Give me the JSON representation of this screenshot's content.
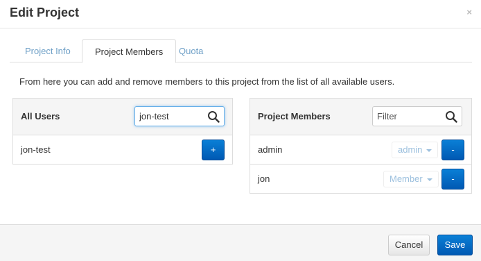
{
  "modal": {
    "title": "Edit Project",
    "close_glyph": "×"
  },
  "tabs": [
    {
      "label": "Project Info",
      "active": false
    },
    {
      "label": "Project Members",
      "active": true
    },
    {
      "label": "Quota",
      "active": false
    }
  ],
  "intro_text": "From here you can add and remove members to this project from the list of all available users.",
  "all_users": {
    "title": "All Users",
    "search_value": "jon-test",
    "search_placeholder": "",
    "rows": [
      {
        "name": "jon-test",
        "action_label": "+"
      }
    ]
  },
  "project_members": {
    "title": "Project Members",
    "search_value": "",
    "search_placeholder": "Filter",
    "rows": [
      {
        "name": "admin",
        "role": "admin",
        "action_label": "-"
      },
      {
        "name": "jon",
        "role": "Member",
        "action_label": "-"
      }
    ]
  },
  "footer": {
    "cancel_label": "Cancel",
    "save_label": "Save"
  },
  "icons": {
    "search": "search-icon",
    "close": "close-icon",
    "dropdown": "chevron-down-icon"
  },
  "colors": {
    "primary": "#0a7fd6",
    "tab_link": "#6fa0c7",
    "role_text": "#9cc0de"
  }
}
